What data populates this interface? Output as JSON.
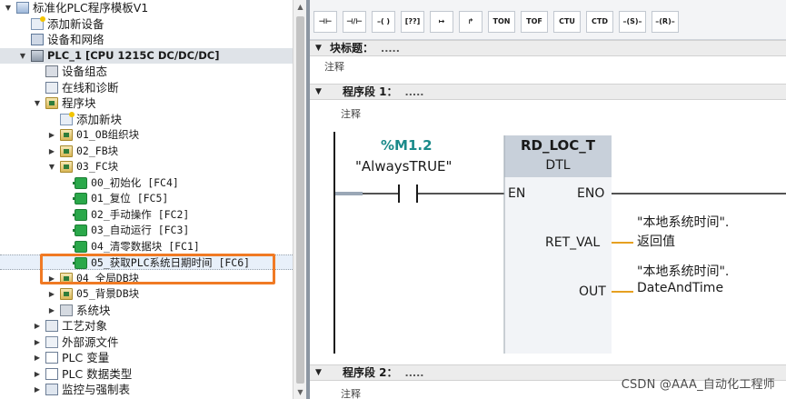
{
  "tree": {
    "items": [
      {
        "label": "标准化PLC程序模板V1",
        "indent": 0,
        "toggle": "▼",
        "icon": "project-icon",
        "cls": "i-proj"
      },
      {
        "label": "添加新设备",
        "indent": 1,
        "toggle": "",
        "icon": "add-device-icon",
        "cls": "i-add"
      },
      {
        "label": "设备和网络",
        "indent": 1,
        "toggle": "",
        "icon": "network-icon",
        "cls": "i-net"
      },
      {
        "label": "PLC_1 [CPU 1215C DC/DC/DC]",
        "indent": 1,
        "toggle": "▼",
        "icon": "plc-icon",
        "cls": "i-plc",
        "style": "bold",
        "selected": true
      },
      {
        "label": "设备组态",
        "indent": 2,
        "toggle": "",
        "icon": "device-config-icon",
        "cls": "i-cfg"
      },
      {
        "label": "在线和诊断",
        "indent": 2,
        "toggle": "",
        "icon": "diagnostics-icon",
        "cls": "i-diag"
      },
      {
        "label": "程序块",
        "indent": 2,
        "toggle": "▼",
        "icon": "program-blocks-folder-icon",
        "cls": "i-folder"
      },
      {
        "label": "添加新块",
        "indent": 3,
        "toggle": "",
        "icon": "add-block-icon",
        "cls": "i-add"
      },
      {
        "label": "01_OB组织块",
        "indent": 3,
        "toggle": "▶",
        "icon": "folder-icon",
        "cls": "i-folder",
        "style": "mono"
      },
      {
        "label": "02_FB块",
        "indent": 3,
        "toggle": "▶",
        "icon": "folder-icon",
        "cls": "i-folder",
        "style": "mono"
      },
      {
        "label": "03_FC块",
        "indent": 3,
        "toggle": "▼",
        "icon": "folder-icon",
        "cls": "i-folder",
        "style": "mono"
      },
      {
        "label": "00_初始化 [FC4]",
        "indent": 4,
        "toggle": "",
        "icon": "fc-block-icon",
        "cls": "i-fc",
        "style": "mono"
      },
      {
        "label": "01_复位 [FC5]",
        "indent": 4,
        "toggle": "",
        "icon": "fc-block-icon",
        "cls": "i-fc",
        "style": "mono"
      },
      {
        "label": "02_手动操作 [FC2]",
        "indent": 4,
        "toggle": "",
        "icon": "fc-block-icon",
        "cls": "i-fc",
        "style": "mono"
      },
      {
        "label": "03_自动运行 [FC3]",
        "indent": 4,
        "toggle": "",
        "icon": "fc-block-icon",
        "cls": "i-fc",
        "style": "mono"
      },
      {
        "label": "04_清零数据块 [FC1]",
        "indent": 4,
        "toggle": "",
        "icon": "fc-block-icon",
        "cls": "i-fc",
        "style": "mono"
      },
      {
        "label": "05_获取PLC系统日期时间 [FC6]",
        "indent": 4,
        "toggle": "",
        "icon": "fc-block-icon",
        "cls": "i-fc",
        "style": "mono",
        "highlight": true
      },
      {
        "label": "04_全局DB块",
        "indent": 3,
        "toggle": "▶",
        "icon": "folder-icon",
        "cls": "i-folder",
        "style": "mono"
      },
      {
        "label": "05_背景DB块",
        "indent": 3,
        "toggle": "▶",
        "icon": "folder-icon",
        "cls": "i-folder",
        "style": "mono"
      },
      {
        "label": "系统块",
        "indent": 3,
        "toggle": "▶",
        "icon": "system-blocks-icon",
        "cls": "i-sys"
      },
      {
        "label": "工艺对象",
        "indent": 2,
        "toggle": "▶",
        "icon": "technology-objects-icon",
        "cls": "i-tech"
      },
      {
        "label": "外部源文件",
        "indent": 2,
        "toggle": "▶",
        "icon": "external-source-icon",
        "cls": "i-ext"
      },
      {
        "label": "PLC 变量",
        "indent": 2,
        "toggle": "▶",
        "icon": "plc-tags-icon",
        "cls": "i-tag"
      },
      {
        "label": "PLC 数据类型",
        "indent": 2,
        "toggle": "▶",
        "icon": "plc-data-types-icon",
        "cls": "i-type"
      },
      {
        "label": "监控与强制表",
        "indent": 2,
        "toggle": "▶",
        "icon": "watch-force-tables-icon",
        "cls": "i-mon"
      }
    ]
  },
  "toolbar": {
    "buttons": [
      {
        "label": "⊣⊢",
        "name": "no-contact-button"
      },
      {
        "label": "⊣/⊢",
        "name": "nc-contact-button"
      },
      {
        "label": "–( )",
        "name": "coil-button"
      },
      {
        "label": "[??]",
        "name": "empty-box-button"
      },
      {
        "label": "↦",
        "name": "open-branch-button"
      },
      {
        "label": "↱",
        "name": "close-branch-button"
      },
      {
        "label": "TON",
        "name": "ton-button"
      },
      {
        "label": "TOF",
        "name": "tof-button"
      },
      {
        "label": "CTU",
        "name": "ctu-button"
      },
      {
        "label": "CTD",
        "name": "ctd-button"
      },
      {
        "label": "–(S)–",
        "name": "set-coil-button"
      },
      {
        "label": "–(R)–",
        "name": "reset-coil-button"
      }
    ]
  },
  "editor": {
    "block_title": "块标题：",
    "block_title_dots": ".....",
    "block_comment": "注释",
    "network1_title": "程序段 1：",
    "network1_dots": ".....",
    "network1_comment": "注释",
    "network2_title": "程序段 2：",
    "network2_dots": ".....",
    "network2_comment": "注释"
  },
  "ladder": {
    "contact_address": "%M1.2",
    "contact_symbol": "\"AlwaysTRUE\"",
    "block_name": "RD_LOC_T",
    "block_type": "DTL",
    "pin_en": "EN",
    "pin_eno": "ENO",
    "pin_ret": "RET_VAL",
    "pin_out": "OUT",
    "ret_operand_1": "\"本地系统时间\".",
    "ret_operand_2": "返回值",
    "out_operand_1": "\"本地系统时间\".",
    "out_operand_2": "DateAndTime",
    "colors": {
      "address": "#1a8a8a",
      "wire": "#1a1a1a",
      "connector": "#e6a020",
      "block_header": "#c8d0da",
      "block_body": "#f2f4f7"
    }
  },
  "watermark": "CSDN @AAA_自动化工程师"
}
